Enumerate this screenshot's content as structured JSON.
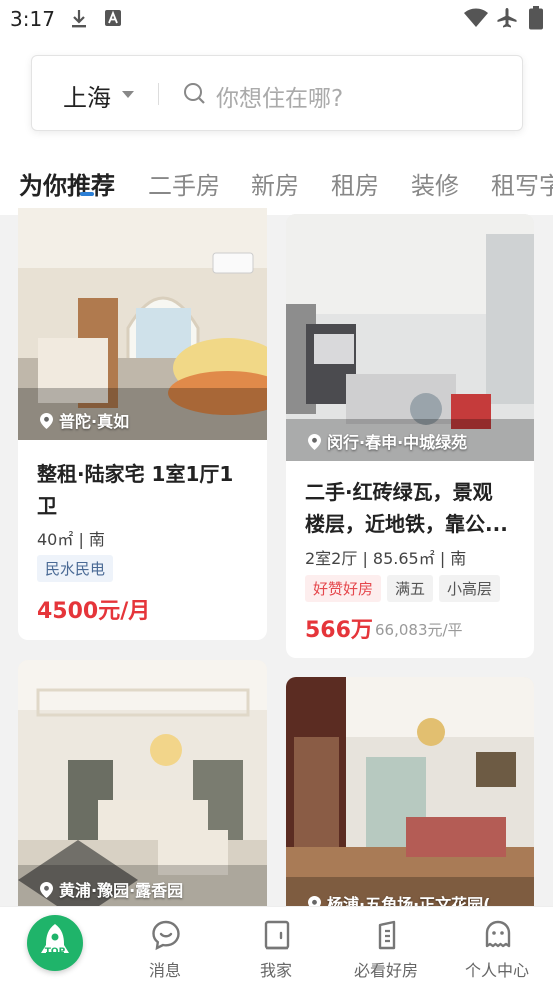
{
  "status_bar": {
    "time": "3:17"
  },
  "search": {
    "city": "上海",
    "placeholder": "你想住在哪?"
  },
  "tabs": [
    {
      "label": "为你推荐",
      "active": true
    },
    {
      "label": "二手房"
    },
    {
      "label": "新房"
    },
    {
      "label": "租房"
    },
    {
      "label": "装修"
    },
    {
      "label": "租写字"
    }
  ],
  "listings": [
    {
      "location": "普陀·真如",
      "title_line1": "整租·陆家宅 1室1厅1",
      "title_line2": "卫",
      "specs": "40㎡ | 南",
      "tags": [
        "民水民电"
      ],
      "price": "4500元/月"
    },
    {
      "location": "闵行·春申·中城绿苑",
      "title_line1": "二手·红砖绿瓦，景观",
      "title_line2": "楼层，近地铁，靠公...",
      "specs": "2室2厅 | 85.65㎡ | 南",
      "tags": [
        "好赞好房",
        "满五",
        "小高层"
      ],
      "price": "566万",
      "unit_price": "66,083元/平"
    },
    {
      "location": "黄浦·豫园·露香园"
    },
    {
      "location": "杨浦·五角场·正文花园("
    }
  ],
  "bottom_nav": {
    "top_badge": "TOP",
    "items": [
      {
        "label": "消息",
        "icon": "message-icon"
      },
      {
        "label": "我家",
        "icon": "home-icon"
      },
      {
        "label": "必看好房",
        "icon": "must-see-icon"
      },
      {
        "label": "个人中心",
        "icon": "profile-icon"
      }
    ]
  },
  "colors": {
    "price_red": "#e5353a",
    "brand_green": "#1fb46a",
    "tab_accent": "#2b7fd6"
  }
}
